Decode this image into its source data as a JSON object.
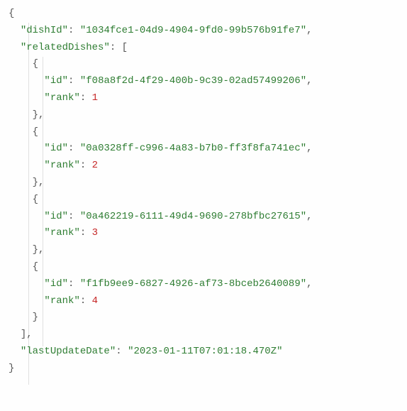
{
  "json": {
    "props": {
      "dishId": "dishId",
      "relatedDishes": "relatedDishes",
      "id": "id",
      "rank": "rank",
      "lastUpdateDate": "lastUpdateDate"
    },
    "values": {
      "dishId": "1034fce1-04d9-4904-9fd0-99b576b91fe7",
      "relatedDishes": [
        {
          "id": "f08a8f2d-4f29-400b-9c39-02ad57499206",
          "rank": 1
        },
        {
          "id": "0a0328ff-c996-4a83-b7b0-ff3f8fa741ec",
          "rank": 2
        },
        {
          "id": "0a462219-6111-49d4-9690-278bfbc27615",
          "rank": 3
        },
        {
          "id": "f1fb9ee9-6827-4926-af73-8bceb2640089",
          "rank": 4
        }
      ],
      "lastUpdateDate": "2023-01-11T07:01:18.470Z"
    },
    "punct": {
      "braceOpen": "{",
      "braceClose": "}",
      "bracketOpen": "[",
      "bracketClose": "]",
      "comma": ",",
      "colon": ":",
      "quote": "\""
    }
  }
}
